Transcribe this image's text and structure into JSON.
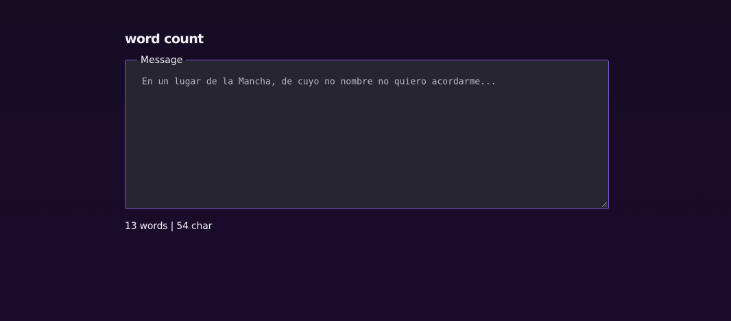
{
  "page": {
    "title": "word count"
  },
  "form": {
    "legend": "Message",
    "message_value": "En un lugar de la Mancha, de cuyo no nombre no quiero acordarme..."
  },
  "counter": {
    "text": "13 words | 54 char",
    "words": 13,
    "chars": 54
  },
  "colors": {
    "background": "#170c26",
    "field_background": "#27252f",
    "field_border": "#7b52c9",
    "text": "#ffffff",
    "field_text": "#b9b6c2"
  }
}
